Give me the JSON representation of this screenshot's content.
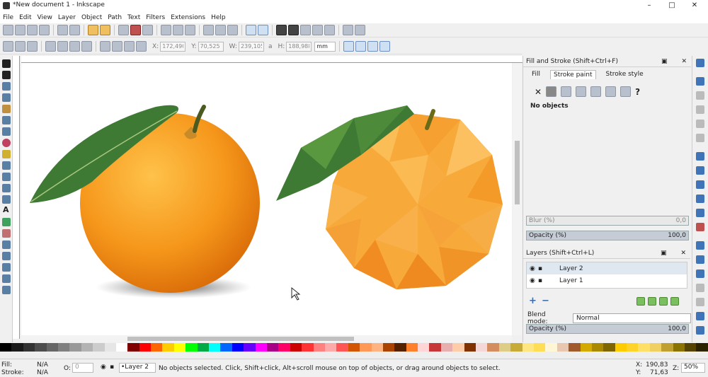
{
  "window": {
    "title": "*New document 1 - Inkscape",
    "minimize": "–",
    "maximize": "□",
    "close": "✕"
  },
  "menu": [
    "File",
    "Edit",
    "View",
    "Layer",
    "Object",
    "Path",
    "Text",
    "Filters",
    "Extensions",
    "Help"
  ],
  "toolbar": {
    "x_label": "X:",
    "x_value": "172,490",
    "y_label": "Y:",
    "y_value": "70,525",
    "w_label": "W:",
    "w_value": "239,105",
    "lock_label": "a",
    "h_label": "H:",
    "h_value": "188,988",
    "unit": "mm"
  },
  "fill_stroke": {
    "title": "Fill and Stroke (Shift+Ctrl+F)",
    "tabs": [
      "Fill",
      "Stroke paint",
      "Stroke style"
    ],
    "none_symbol": "✕",
    "help_symbol": "?",
    "no_objects": "No objects",
    "blur_label": "Blur (%)",
    "blur_value": "0,0",
    "opacity_label": "Opacity (%)",
    "opacity_value": "100,0"
  },
  "layers": {
    "title": "Layers (Shift+Ctrl+L)",
    "items": [
      "Layer 2",
      "Layer 1"
    ],
    "add_symbol": "+",
    "remove_symbol": "−",
    "blend_label": "Blend mode:",
    "blend_value": "Normal",
    "opacity_label": "Opacity (%)",
    "opacity_value": "100,0"
  },
  "status": {
    "fill_label": "Fill:",
    "fill_value": "N/A",
    "stroke_label": "Stroke:",
    "stroke_value": "N/A",
    "o_label": "O:",
    "o_value": "0",
    "layer": "•Layer 2",
    "message": "No objects selected. Click, Shift+click, Alt+scroll mouse on top of objects, or drag around objects to select.",
    "x_label": "X:",
    "x_value": "190,83",
    "y_label": "Y:",
    "y_value": "71,63",
    "z_label": "Z:",
    "z_value": "50%"
  },
  "palette": [
    "#000000",
    "#1a1a1a",
    "#333333",
    "#4d4d4d",
    "#666666",
    "#808080",
    "#999999",
    "#b3b3b3",
    "#cccccc",
    "#e6e6e6",
    "#ffffff",
    "#800000",
    "#ff0000",
    "#ff6600",
    "#ffcc00",
    "#ffff00",
    "#00ff00",
    "#00aa44",
    "#00ffff",
    "#0066ff",
    "#0000ff",
    "#6600ff",
    "#ff00ff",
    "#aa0088",
    "#ff0066",
    "#cc0000",
    "#ff3333",
    "#ff8080",
    "#ffaaaa",
    "#ff5555",
    "#d45500",
    "#ff9955",
    "#ffb380",
    "#aa4400",
    "#552200",
    "#ff7f2a",
    "#ffd5d5",
    "#c83737",
    "#e9afaf",
    "#ffccaa",
    "#803300",
    "#f4d7d7",
    "#d38d5f",
    "#decd87",
    "#c8ab37",
    "#ffe680",
    "#ffdd55",
    "#fff6d5",
    "#e9c6af",
    "#a05a2c",
    "#d4aa00",
    "#aa8800",
    "#806600",
    "#ffcc00",
    "#ffd42a",
    "#ffe066",
    "#f0d060",
    "#c0a030",
    "#8b7300",
    "#554400",
    "#2b2200"
  ],
  "art": {
    "leaf": "#3f7a35",
    "orange": "#f59a1e",
    "lowpoly": "#f7a93a"
  }
}
